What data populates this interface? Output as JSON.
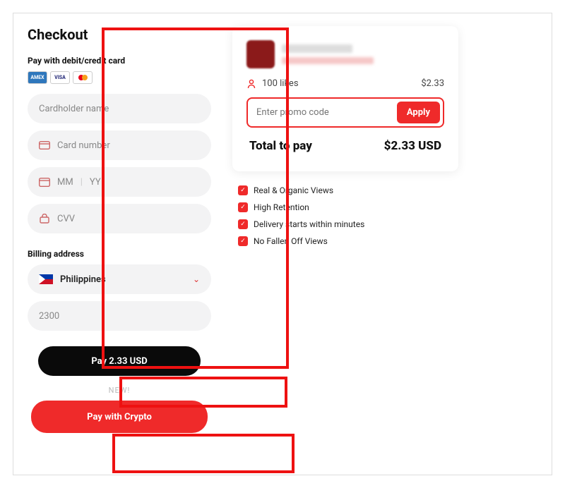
{
  "checkout": {
    "title": "Checkout",
    "pay_with_card_label": "Pay with debit/credit card",
    "brands": {
      "amex": "AMEX",
      "visa": "VISA"
    },
    "fields": {
      "cardholder_placeholder": "Cardholder name",
      "cardnumber_placeholder": "Card number",
      "mm_placeholder": "MM",
      "yy_placeholder": "YY",
      "cvv_placeholder": "CVV"
    },
    "billing_label": "Billing address",
    "country_value": "Philippines",
    "postal_value": "2300"
  },
  "buttons": {
    "pay_label": "Pay 2.33 USD",
    "new_tag": "NEW!",
    "crypto_label": "Pay with Crypto"
  },
  "summary": {
    "likes_label": "100 likes",
    "likes_price": "$2.33",
    "promo_placeholder": "Enter promo code",
    "apply_label": "Apply",
    "total_label": "Total to pay",
    "total_value": "$2.33 USD",
    "features": [
      "Real & Organic Views",
      "High Retention",
      "Delivery starts within minutes",
      "No Fallen Off Views"
    ]
  }
}
